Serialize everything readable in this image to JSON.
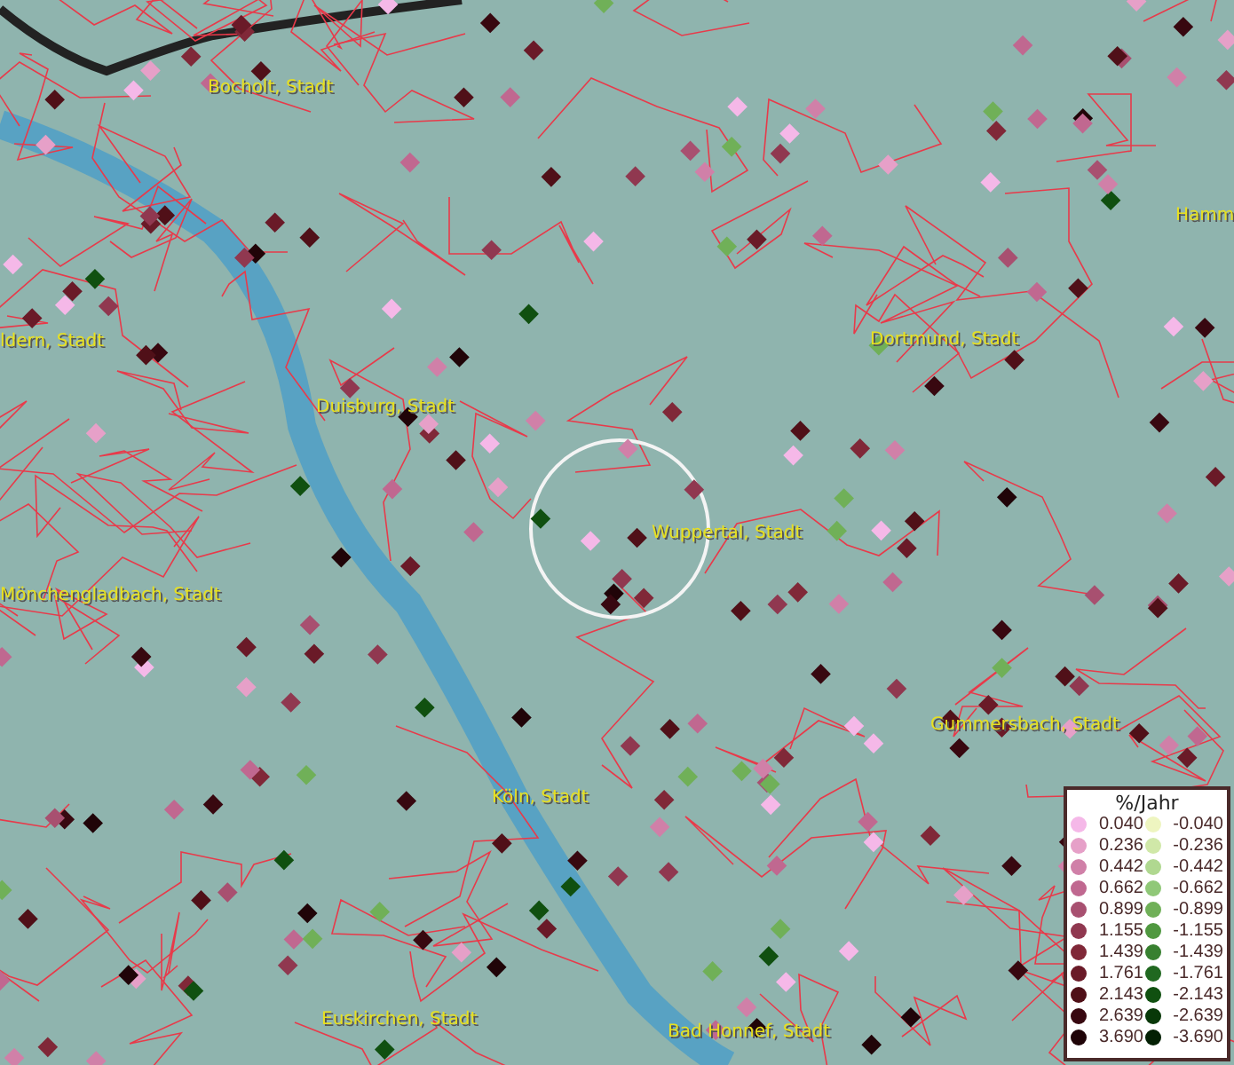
{
  "map": {
    "place_labels": [
      {
        "text": "Bocholt, Stadt"
      },
      {
        "text": "Hamm"
      },
      {
        "text": "ldern, Stadt"
      },
      {
        "text": "Dortmund, Stadt"
      },
      {
        "text": "Duisburg, Stadt"
      },
      {
        "text": "Wuppertal, Stadt"
      },
      {
        "text": "Mönchengladbach, Stadt"
      },
      {
        "text": "Gummersbach, Stadt"
      },
      {
        "text": "Köln, Stadt"
      },
      {
        "text": "Euskirchen, Stadt"
      },
      {
        "text": "Bad Honnef, Stadt"
      }
    ]
  },
  "legend": {
    "title": "%/Jahr",
    "rows": [
      {
        "positive": {
          "value": "0.040",
          "color": "#f5b8e8"
        },
        "negative": {
          "value": "-0.040",
          "color": "#eef5c0"
        }
      },
      {
        "positive": {
          "value": "0.236",
          "color": "#e6a0c8"
        },
        "negative": {
          "value": "-0.236",
          "color": "#d0e8a8"
        }
      },
      {
        "positive": {
          "value": "0.442",
          "color": "#d080a8"
        },
        "negative": {
          "value": "-0.442",
          "color": "#b0d890"
        }
      },
      {
        "positive": {
          "value": "0.662",
          "color": "#c06890"
        },
        "negative": {
          "value": "-0.662",
          "color": "#90c878"
        }
      },
      {
        "positive": {
          "value": "0.899",
          "color": "#a85070"
        },
        "negative": {
          "value": "-0.899",
          "color": "#70b058"
        }
      },
      {
        "positive": {
          "value": "1.155",
          "color": "#903850"
        },
        "negative": {
          "value": "-1.155",
          "color": "#509840"
        }
      },
      {
        "positive": {
          "value": "1.439",
          "color": "#802838"
        },
        "negative": {
          "value": "-1.439",
          "color": "#388030"
        }
      },
      {
        "positive": {
          "value": "1.761",
          "color": "#6a1a28"
        },
        "negative": {
          "value": "-1.761",
          "color": "#206820"
        }
      },
      {
        "positive": {
          "value": "2.143",
          "color": "#501018"
        },
        "negative": {
          "value": "-2.143",
          "color": "#105010"
        }
      },
      {
        "positive": {
          "value": "2.639",
          "color": "#380810"
        },
        "negative": {
          "value": "-2.639",
          "color": "#083808"
        }
      },
      {
        "positive": {
          "value": "3.690",
          "color": "#200408"
        },
        "negative": {
          "value": "-3.690",
          "color": "#042004"
        }
      }
    ]
  }
}
